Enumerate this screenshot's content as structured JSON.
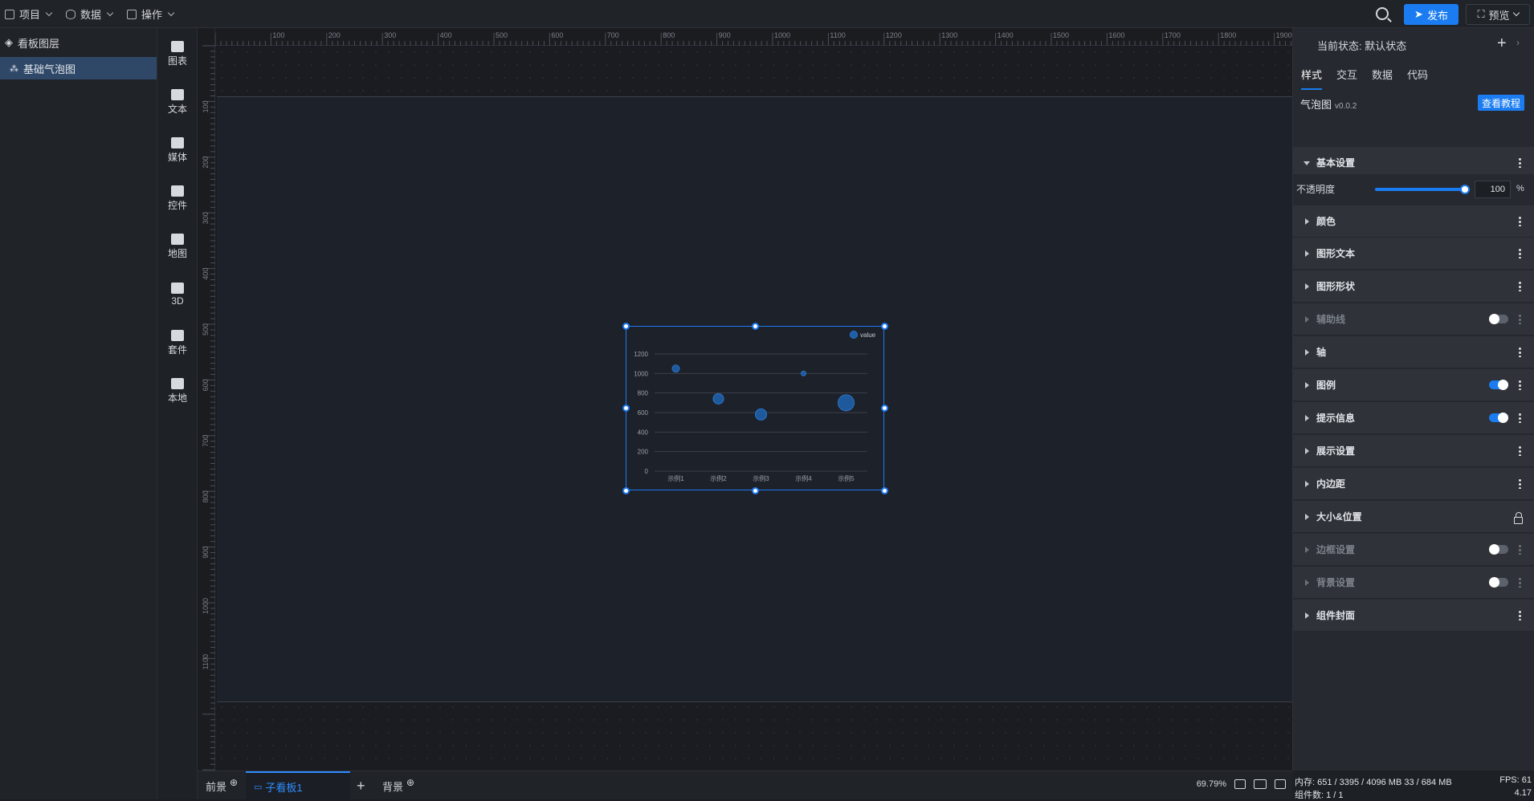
{
  "topbar": {
    "menus": [
      {
        "label": "项目",
        "icon": "file-icon"
      },
      {
        "label": "数据",
        "icon": "database-icon"
      },
      {
        "label": "操作",
        "icon": "grid-icon"
      }
    ],
    "publish_label": "发布",
    "preview_label": "预览"
  },
  "layers": {
    "title": "看板图层",
    "items": [
      {
        "label": "基础气泡图"
      }
    ]
  },
  "toolbox": {
    "items": [
      {
        "label": "图表",
        "icon": "chart-icon"
      },
      {
        "label": "文本",
        "icon": "text-icon"
      },
      {
        "label": "媒体",
        "icon": "media-icon"
      },
      {
        "label": "控件",
        "icon": "widget-icon"
      },
      {
        "label": "地图",
        "icon": "map-icon"
      },
      {
        "label": "3D",
        "icon": "cube-icon"
      },
      {
        "label": "套件",
        "icon": "kit-icon"
      },
      {
        "label": "本地",
        "icon": "puzzle-icon"
      }
    ]
  },
  "rulers": {
    "top_ticks": [
      "100",
      "200",
      "300",
      "400",
      "500",
      "600",
      "700",
      "800",
      "900",
      "1000",
      "1100",
      "1200",
      "1300",
      "1400",
      "1500",
      "1600",
      "1700",
      "1800",
      "1900"
    ],
    "left_ticks": [
      "100",
      "200",
      "300",
      "400",
      "500",
      "600",
      "700",
      "800",
      "900",
      "1000",
      "1100"
    ]
  },
  "chart_data": {
    "type": "scatter",
    "categories": [
      "示例1",
      "示例2",
      "示例3",
      "示例4",
      "示例5"
    ],
    "series": [
      {
        "name": "value",
        "values": [
          1050,
          740,
          580,
          1000,
          700
        ],
        "sizes": [
          7,
          11,
          12,
          4,
          18
        ]
      }
    ],
    "ylim": [
      0,
      1200
    ],
    "yticks": [
      "0",
      "200",
      "400",
      "600",
      "800",
      "1000",
      "1200"
    ],
    "grid": true,
    "legend": "top-right",
    "color": "#1f5fa8"
  },
  "bottombar": {
    "tabs": [
      {
        "label": "前景"
      },
      {
        "label": "子看板1"
      },
      {
        "label": "背景"
      }
    ],
    "zoom": "69.79%"
  },
  "panel": {
    "state_label": "当前状态:",
    "state_value": "默认状态",
    "tabs": [
      "样式",
      "交互",
      "数据",
      "代码"
    ],
    "component_name": "气泡图",
    "component_version": "v0.0.2",
    "tutorial_label": "查看教程",
    "opacity_label": "不透明度",
    "opacity_value": "100",
    "opacity_unit": "%",
    "sections": [
      {
        "label": "基本设置",
        "expanded": true
      },
      {
        "label": "颜色"
      },
      {
        "label": "图形文本"
      },
      {
        "label": "图形形状"
      },
      {
        "label": "辅助线",
        "toggle": "off",
        "dim": true
      },
      {
        "label": "轴"
      },
      {
        "label": "图例",
        "toggle": "on"
      },
      {
        "label": "提示信息",
        "toggle": "on"
      },
      {
        "label": "展示设置"
      },
      {
        "label": "内边距"
      },
      {
        "label": "大小&位置",
        "lock": true
      },
      {
        "label": "边框设置",
        "toggle": "off",
        "dim": true
      },
      {
        "label": "背景设置",
        "toggle": "off",
        "dim": true
      },
      {
        "label": "组件封面"
      }
    ]
  },
  "status": {
    "memory": "内存: 651 / 3395 / 4096 MB 33 / 684 MB",
    "fps": "FPS: 61",
    "components": "组件数: 1 / 1",
    "version": "4.17"
  }
}
